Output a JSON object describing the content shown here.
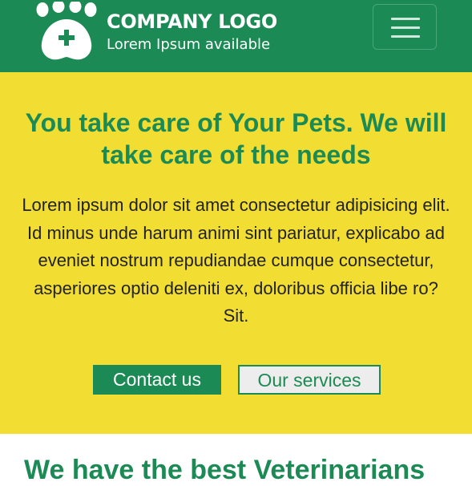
{
  "header": {
    "logo_title": "COMPANY LOGO",
    "logo_subtitle": "Lorem Ipsum available",
    "logo_icon": "paw-with-plus-icon",
    "menu_icon": "hamburger-menu-icon"
  },
  "hero": {
    "title": "You take care of Your Pets. We will take care of the needs",
    "text": "Lorem ipsum dolor sit amet consectetur adipisicing elit. Id minus unde harum animi sint pariatur, explicabo ad eveniet nostrum repudiandae cumque consectetur, asperiores optio deleniti ex, doloribus officia libe ro? Sit.",
    "contact_label": "Contact us",
    "services_label": "Our services"
  },
  "next_section": {
    "heading": "We have the best Veterinarians"
  },
  "colors": {
    "primary_green": "#1c8a54",
    "hero_yellow": "#f2de33",
    "secondary_button_bg": "#ededed",
    "body_text": "#222222"
  }
}
